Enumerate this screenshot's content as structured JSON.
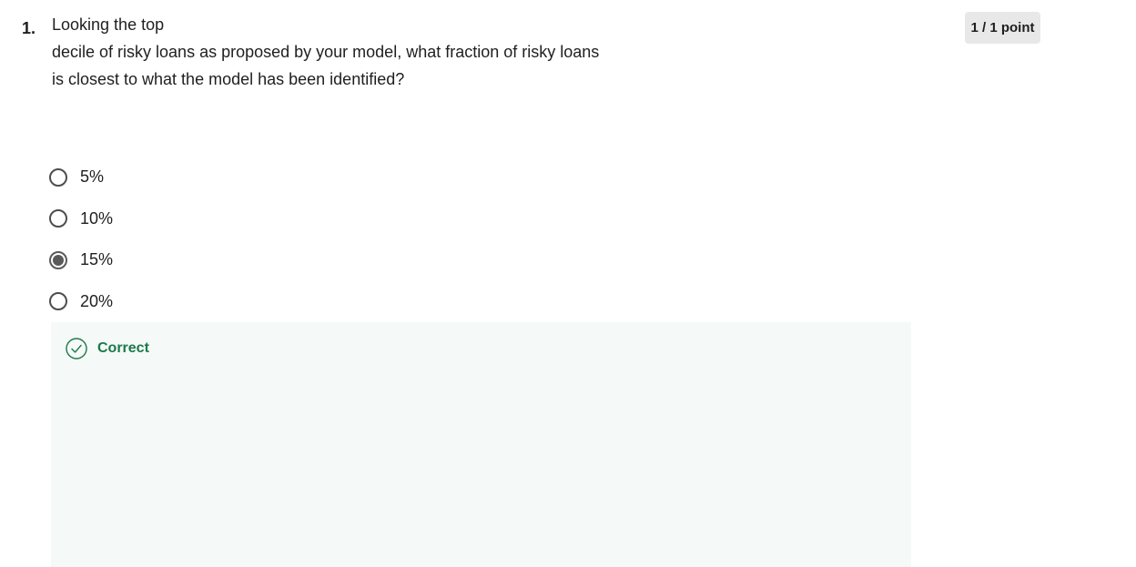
{
  "question": {
    "number": "1.",
    "lines": [
      "Looking the top",
      "decile of risky loans as proposed by your model, what fraction of risky loans",
      "is closest to what the model has been identified?"
    ]
  },
  "score": "1 / 1 point",
  "options": [
    {
      "label": "5%",
      "selected": false
    },
    {
      "label": "10%",
      "selected": false
    },
    {
      "label": "15%",
      "selected": true
    },
    {
      "label": "20%",
      "selected": false
    }
  ],
  "feedback": {
    "status": "Correct",
    "icon": "check-circle-icon",
    "color": "#1b7a4a",
    "background": "#f5f9f7"
  }
}
